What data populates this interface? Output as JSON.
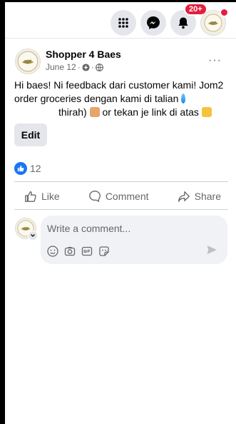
{
  "header": {
    "notification_badge": "20+"
  },
  "post": {
    "author": "Shopper 4 Baes",
    "date": "June 12",
    "meta_separator": "·",
    "more_label": "···",
    "text_line1": "Hi baes! Ni feedback dari customer kami! Jom2 order groceries dengan kami di talian",
    "text_line2": "thirah)",
    "text_line3": "or tekan je link di atas",
    "edit_label": "Edit",
    "reaction_count": "12"
  },
  "actions": {
    "like_label": "Like",
    "comment_label": "Comment",
    "share_label": "Share"
  },
  "comment": {
    "placeholder": "Write a comment..."
  },
  "colors": {
    "accent": "#1877f2",
    "badge": "#e41e3f",
    "muted_text": "#65676b"
  },
  "icons": [
    "menu-grid-icon",
    "messenger-icon",
    "bell-icon",
    "globe-icon",
    "thumbs-up-icon",
    "comment-icon",
    "share-icon",
    "emoji-icon",
    "camera-icon",
    "gif-icon",
    "sticker-icon",
    "send-icon"
  ]
}
